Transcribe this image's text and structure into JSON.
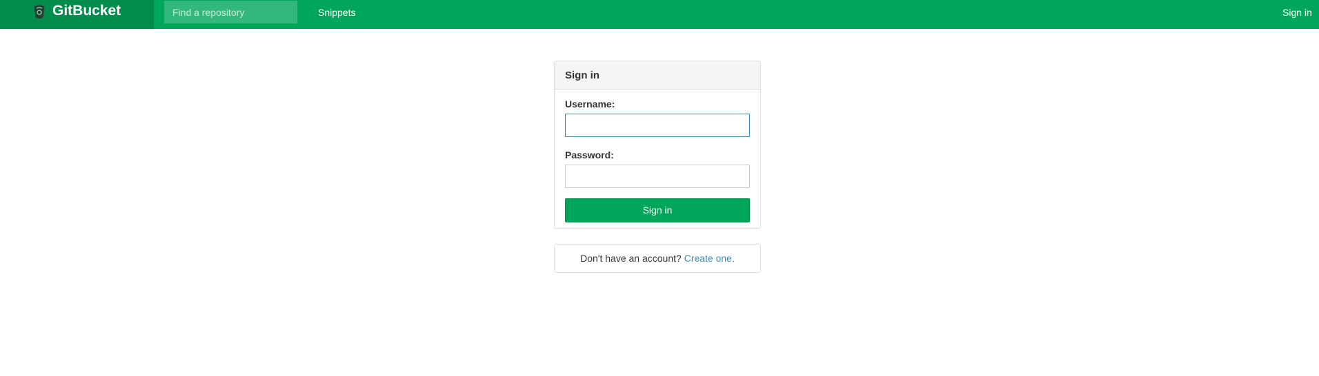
{
  "navbar": {
    "brand": "GitBucket",
    "brand_icon": "gitbucket-logo-icon",
    "search_placeholder": "Find a repository",
    "snippets_label": "Snippets",
    "signin_label": "Sign in"
  },
  "signin_panel": {
    "title": "Sign in",
    "username_label": "Username:",
    "username_value": "",
    "password_label": "Password:",
    "password_value": "",
    "submit_label": "Sign in"
  },
  "signup": {
    "prompt": "Don't have an account?",
    "link_label": "Create one."
  },
  "colors": {
    "navbar": "#00a65a",
    "brand_background": "#008d4c",
    "link": "#3c8dbc"
  }
}
